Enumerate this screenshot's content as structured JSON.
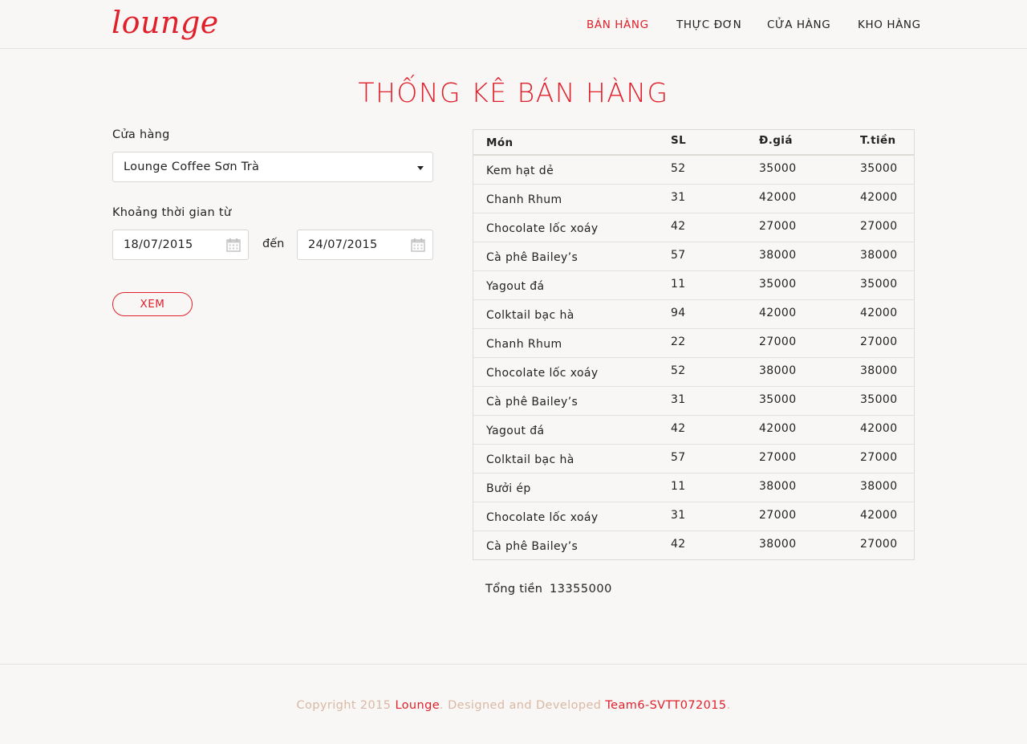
{
  "header": {
    "logo": "lounge",
    "nav": [
      {
        "label": "BÁN HÀNG",
        "active": true
      },
      {
        "label": "THỰC ĐƠN",
        "active": false
      },
      {
        "label": "CỬA HÀNG",
        "active": false
      },
      {
        "label": "KHO HÀNG",
        "active": false
      }
    ]
  },
  "page_title": "THỐNG KÊ BÁN HÀNG",
  "filters": {
    "store_label": "Cửa hàng",
    "store_value": "Lounge Coffee Sơn Trà",
    "period_label": "Khoảng thời gian từ",
    "from_date": "18/07/2015",
    "to_label": "đến",
    "to_date": "24/07/2015",
    "view_button": "XEM"
  },
  "table": {
    "headers": [
      "Món",
      "SL",
      "Đ.giá",
      "T.tiền"
    ],
    "rows": [
      [
        "Kem hạt dẻ",
        "52",
        "35000",
        "35000"
      ],
      [
        "Chanh Rhum",
        "31",
        "42000",
        "42000"
      ],
      [
        "Chocolate lốc xoáy",
        "42",
        "27000",
        "27000"
      ],
      [
        "Cà phê Bailey’s",
        "57",
        "38000",
        "38000"
      ],
      [
        "Yagout đá",
        "11",
        "35000",
        "35000"
      ],
      [
        "Colktail bạc hà",
        "94",
        "42000",
        "42000"
      ],
      [
        "Chanh Rhum",
        "22",
        "27000",
        "27000"
      ],
      [
        "Chocolate lốc xoáy",
        "52",
        "38000",
        "38000"
      ],
      [
        "Cà phê Bailey’s",
        "31",
        "35000",
        "35000"
      ],
      [
        "Yagout đá",
        "42",
        "42000",
        "42000"
      ],
      [
        "Colktail bạc hà",
        "57",
        "27000",
        "27000"
      ],
      [
        "Bưởi ép",
        "11",
        "38000",
        "38000"
      ],
      [
        "Chocolate lốc xoáy",
        "31",
        "27000",
        "42000"
      ],
      [
        "Cà phê Bailey’s",
        "42",
        "38000",
        "27000"
      ]
    ]
  },
  "total": {
    "label": "Tổng tiền",
    "value": "13355000"
  },
  "footer": {
    "prefix": "Copyright 2015 ",
    "brand": "Lounge",
    "middle": ". Designed and Developed ",
    "team": "Team6-SVTT072015",
    "suffix": "."
  },
  "colors": {
    "accent": "#e0202b",
    "background": "#f9f7f5",
    "footer_text": "#d9b8a4"
  }
}
